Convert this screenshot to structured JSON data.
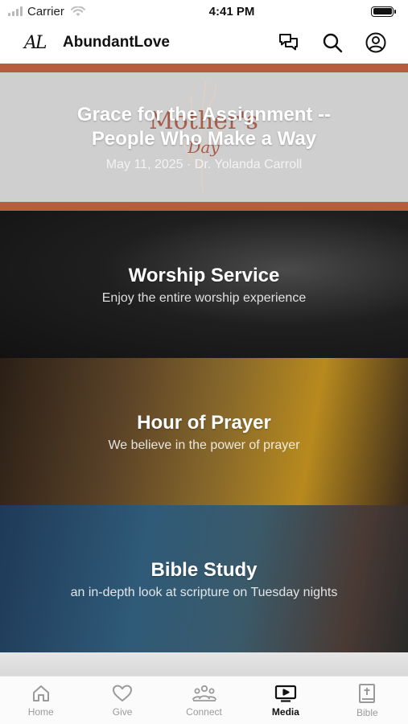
{
  "status_bar": {
    "carrier": "Carrier",
    "time": "4:41 PM"
  },
  "header": {
    "logo_text": "AL",
    "title": "AbundantLove",
    "icons": [
      "chat-icon",
      "search-icon",
      "account-icon"
    ]
  },
  "feed": {
    "featured": {
      "title": "Grace for the Assignment -- People Who Make a Way",
      "subtitle": "May 11, 2025 · Dr. Yolanda Carroll",
      "art_text_line1": "Mother's",
      "art_text_line2": "Day",
      "accent_color": "#b65d40"
    },
    "cards": [
      {
        "title": "Worship Service",
        "subtitle": "Enjoy the entire worship experience"
      },
      {
        "title": "Hour of Prayer",
        "subtitle": "We believe in the power of prayer"
      },
      {
        "title": "Bible Study",
        "subtitle": "an in-depth look at scripture on Tuesday nights"
      }
    ]
  },
  "tabs": [
    {
      "label": "Home",
      "icon": "home-icon",
      "active": false
    },
    {
      "label": "Give",
      "icon": "heart-icon",
      "active": false
    },
    {
      "label": "Connect",
      "icon": "people-icon",
      "active": false
    },
    {
      "label": "Media",
      "icon": "tv-play-icon",
      "active": true
    },
    {
      "label": "Bible",
      "icon": "bible-icon",
      "active": false
    }
  ]
}
